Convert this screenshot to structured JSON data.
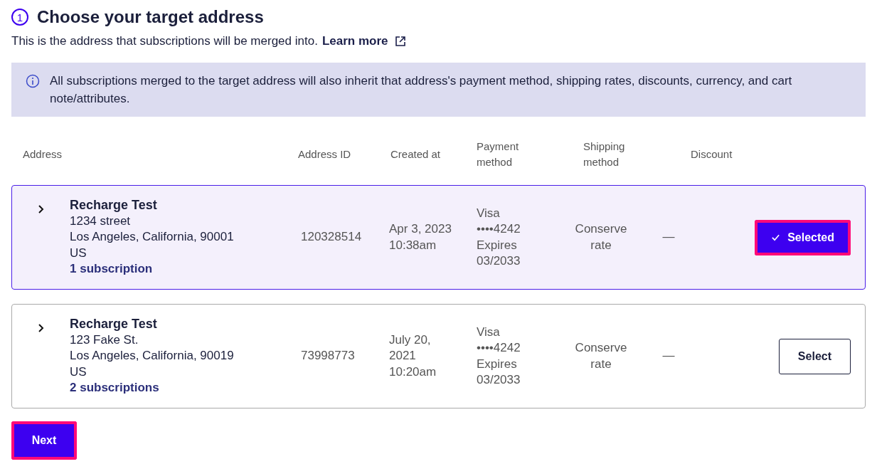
{
  "step": {
    "number": "1",
    "title": "Choose your target address"
  },
  "intro": {
    "text": "This is the address that subscriptions will be merged into.",
    "link": "Learn more"
  },
  "info_banner": {
    "text": "All subscriptions merged to the target address will also inherit that address's payment method, shipping rates, discounts, currency, and cart note/attributes."
  },
  "table": {
    "columns": [
      "Address",
      "Address ID",
      "Created at",
      "Payment method",
      "Shipping method",
      "Discount"
    ],
    "rows": [
      {
        "name": "Recharge Test",
        "street": "1234 street",
        "city": "Los Angeles, California, 90001",
        "country": "US",
        "subscriptions": "1 subscription",
        "address_id": "120328514",
        "created_at": "Apr 3, 2023 10:38am",
        "payment": [
          "Visa",
          "••••4242",
          "Expires",
          "03/2033"
        ],
        "shipping": "Conserve rate",
        "discount": "—",
        "expanded": false,
        "selected": true,
        "button": {
          "label": "Selected",
          "focused": true
        }
      },
      {
        "name": "Recharge Test",
        "street": "123 Fake St.",
        "city": "Los Angeles, California, 90019",
        "country": "US",
        "subscriptions": "2 subscriptions",
        "address_id": "73998773",
        "created_at": "July 20, 2021 10:20am",
        "payment": [
          "Visa",
          "••••4242",
          "Expires",
          "03/2033"
        ],
        "shipping": "Conserve rate",
        "discount": "—",
        "expanded": false,
        "selected": false,
        "button": {
          "label": "Select",
          "focused": false
        }
      }
    ]
  },
  "next_button": {
    "label": "Next",
    "focused": true
  }
}
